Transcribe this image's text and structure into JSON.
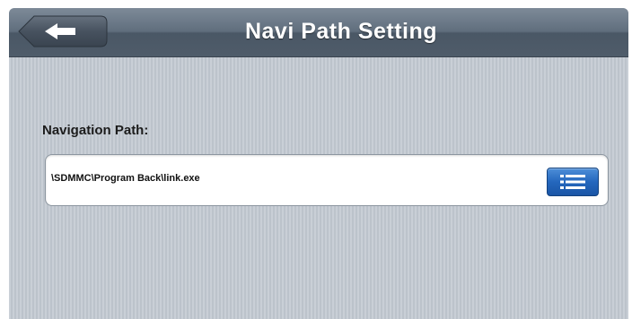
{
  "header": {
    "title": "Navi Path Setting",
    "back_icon": "arrow-left-icon"
  },
  "navigation_path": {
    "label": "Navigation Path:",
    "value": "\\SDMMC\\Program Back\\link.exe",
    "browse_icon": "list-icon"
  },
  "colors": {
    "title_bar": "#5b6877",
    "background": "#c3cad2",
    "browse_button": "#2467bd"
  }
}
